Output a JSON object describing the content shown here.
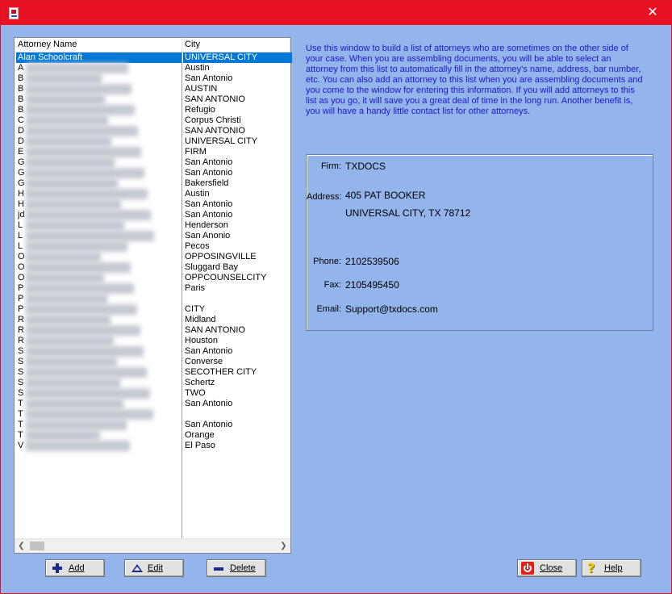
{
  "window": {
    "close_glyph": "✕"
  },
  "list": {
    "headers": {
      "name": "Attorney Name",
      "city": "City"
    },
    "rows": [
      {
        "name": "Alan Schoolcraft",
        "city": "UNIVERSAL CITY",
        "selected": true
      },
      {
        "name": "A",
        "city": "Austin"
      },
      {
        "name": "B",
        "city": "San Antonio"
      },
      {
        "name": "B",
        "city": "AUSTIN"
      },
      {
        "name": "B",
        "city": "SAN ANTONIO"
      },
      {
        "name": "B",
        "city": "Refugio"
      },
      {
        "name": "C",
        "city": "Corpus Christi"
      },
      {
        "name": "D",
        "city": "SAN ANTONIO"
      },
      {
        "name": "D",
        "city": "UNIVERSAL CITY"
      },
      {
        "name": "E",
        "city": "FIRM"
      },
      {
        "name": "G",
        "city": "San Antonio"
      },
      {
        "name": "G",
        "city": "San Antonio"
      },
      {
        "name": "G",
        "city": "Bakersfield"
      },
      {
        "name": "H",
        "city": "Austin"
      },
      {
        "name": "H",
        "city": "San Antonio"
      },
      {
        "name": "jd",
        "city": "San Antonio"
      },
      {
        "name": "L",
        "city": "Henderson"
      },
      {
        "name": "L",
        "city": "San Anonio"
      },
      {
        "name": "L",
        "city": "Pecos"
      },
      {
        "name": "O",
        "city": "OPPOSINGVILLE"
      },
      {
        "name": "O",
        "city": "Sluggard Bay"
      },
      {
        "name": "O",
        "city": "OPPCOUNSELCITY"
      },
      {
        "name": "P",
        "city": "Paris"
      },
      {
        "name": "P",
        "city": ""
      },
      {
        "name": "P",
        "city": "CITY"
      },
      {
        "name": "R",
        "city": "Midland"
      },
      {
        "name": "R",
        "city": "SAN ANTONIO"
      },
      {
        "name": "R",
        "city": "Houston"
      },
      {
        "name": "S",
        "city": "San Antonio"
      },
      {
        "name": "S",
        "city": "Converse"
      },
      {
        "name": "S",
        "city": "SECOTHER CITY"
      },
      {
        "name": "S",
        "city": "Schertz"
      },
      {
        "name": "S",
        "city": "TWO"
      },
      {
        "name": "T",
        "city": "San Antonio"
      },
      {
        "name": "T",
        "city": ""
      },
      {
        "name": "T",
        "city": "San Antonio"
      },
      {
        "name": "T",
        "city": "Orange"
      },
      {
        "name": "V",
        "city": "El Paso"
      }
    ]
  },
  "info_text": "Use this window to build a list of attorneys who are sometimes on the other side of your case.  When you are assembling documents, you will be able to select an attorney from this list to automatically fill in the attorney's name, address, bar number, etc.  You can also add an attorney to this list when you are assembling documents and you come to the window for entering this information.  If you will add attorneys to this list as you go, it will save you a great deal of time in the long run. Another benefit is, you will have a handy little contact list for other attorneys.",
  "details": {
    "firm_label": "Firm:",
    "firm": "TXDOCS",
    "address_label": "Address:",
    "address_line1": "405 PAT BOOKER",
    "address_line2": "UNIVERSAL CITY, TX  78712",
    "phone_label": "Phone:",
    "phone": "2102539506",
    "fax_label": "Fax:",
    "fax": "2105495450",
    "email_label": "Email:",
    "email": "Support@txdocs.com"
  },
  "buttons": {
    "add": "Add",
    "edit": "Edit",
    "delete": "Delete",
    "close": "Close",
    "help": "Help"
  },
  "icons": {
    "add": "plus-icon",
    "edit": "triangle-icon",
    "delete": "minus-icon",
    "close": "power-icon",
    "help": "question-icon"
  },
  "colors": {
    "titlebar": "#e81123",
    "background": "#94b4ec",
    "selection": "#0078d7",
    "info_text": "#1a1ac8"
  }
}
